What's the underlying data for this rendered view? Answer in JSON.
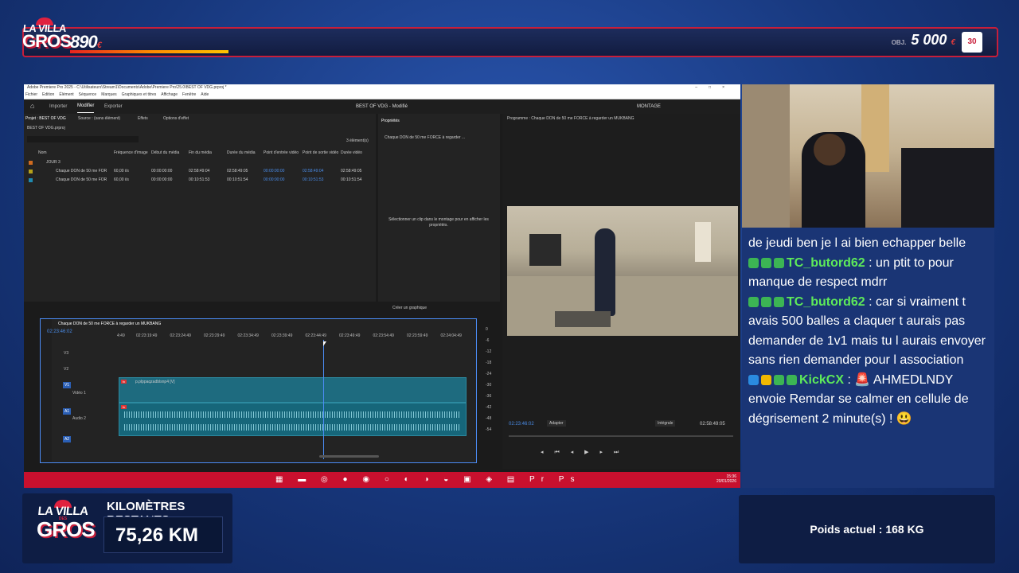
{
  "overlay": {
    "top_counter": {
      "value": "890",
      "currency": "€"
    },
    "top_goal": {
      "label": "OBJ.",
      "value": "5 000",
      "currency": "€"
    },
    "progress_fraction": 0.178,
    "badge": "30",
    "logo": {
      "line1": "LA VILLA",
      "line2": "GROS",
      "small": "DES"
    }
  },
  "premiere": {
    "window_title": "Adobe Premiere Pro 2025 - C:\\Utilisateurs\\Stream1\\Documents\\Adobe\\Premiere Pro\\25.0\\BEST OF VDG.prproj *",
    "menu": [
      "Fichier",
      "Edition",
      "Élément",
      "Séquence",
      "Marques",
      "Graphiques et titres",
      "Affichage",
      "Fenêtre",
      "Aide"
    ],
    "header_tabs": [
      "Importer",
      "Modifier",
      "Exporter"
    ],
    "project_title": "BEST OF VDG - Modifié",
    "workspace": "MONTAGE",
    "project_panel": {
      "tabs": [
        "Projet : BEST OF VDG",
        "Source : (sans élément)",
        "Effets",
        "Options d'effet"
      ],
      "file": "BEST OF VDG.prproj",
      "count": "3 élément(s)",
      "columns": [
        "Nom",
        "Fréquence d'image",
        "Début du média",
        "Fin du média",
        "Durée du média",
        "Point d'entrée vidéo",
        "Point de sortie vidéo",
        "Durée vidéo"
      ],
      "rows": [
        {
          "name": "JOUR 3",
          "fps": "",
          "start": "",
          "end": "",
          "dur": "",
          "in": "",
          "out": "",
          "vdur": ""
        },
        {
          "name": "Chaque DON de 50 me FOR",
          "fps": "60,00 i/s",
          "start": "00:00:00:00",
          "end": "02:58:49:04",
          "dur": "02:58:49:05",
          "in": "00:00:00:00",
          "out": "02:58:49:04",
          "vdur": "02:58:49:05"
        },
        {
          "name": "Chaque DON de 50 me FOR",
          "fps": "60,00 i/s",
          "start": "00:00:00:00",
          "end": "00:10:51:53",
          "dur": "00:10:51:54",
          "in": "00:00:00:00",
          "out": "00:10:51:53",
          "vdur": "00:10:51:54"
        }
      ]
    },
    "properties_panel": {
      "title": "Propriétés",
      "item": "Chaque DON de 50 me FORCE à regarder ...",
      "empty_msg": "Sélectionner un clip dans le montage pour en afficher les propriétés.",
      "create_graphic": "Créer un graphique"
    },
    "program_panel": {
      "title": "Programme : Chaque DON de 50 me FORCE à regarder un MUKBANG",
      "timecode": "02:23:46:02",
      "fit": "Adapter",
      "quality": "Intégrale",
      "duration": "02:58:49:05"
    },
    "timeline": {
      "tab": "Chaque DON de 50 me FORCE à regarder un MUKBANG",
      "timecode": "02:23:46:02",
      "ruler": [
        "4:49",
        "02:23:19:49",
        "02:23:24:49",
        "02:23:29:49",
        "02:23:34:49",
        "02:23:39:49",
        "02:23:44:49",
        "02:23:49:49",
        "02:23:54:49",
        "02:23:59:49",
        "02:24:04:49"
      ],
      "tracks": [
        "V3",
        "V2",
        "V1",
        "A1",
        "A2"
      ],
      "video1_label": "Vidéo 1",
      "audio2_label": "Audio 2",
      "clip_name": "p.plppaqzadblsnp4 [V]",
      "meter_scale": [
        "0",
        "-6",
        "-12",
        "-18",
        "-24",
        "-30",
        "-36",
        "-42",
        "-48",
        "-54"
      ]
    },
    "taskbar": {
      "time": "15:36",
      "date": "20/01/2026"
    }
  },
  "chat": [
    {
      "user": "",
      "text": "de jeudi ben je l ai bien echapper belle",
      "icons": []
    },
    {
      "user": "TC_butord62",
      "text": "un ptit to pour manque de respect mdrr",
      "icons": [
        "#3cb554",
        "#3cb554",
        "#3cb554"
      ]
    },
    {
      "user": "TC_butord62",
      "text": "car si vraiment t avais 500 balles a claquer t aurais pas demander de 1v1 mais tu l aurais envoyer sans rien demander pour l association",
      "icons": [
        "#3cb554",
        "#3cb554",
        "#3cb554"
      ]
    },
    {
      "user": "KickCX",
      "text": "🚨 AHMEDLNDY envoie Remdar se calmer en cellule de dégrisement 2 minute(s) ! 😃",
      "icons": [
        "#2a8be0",
        "#f0b800",
        "#3cb554",
        "#3cb554"
      ]
    }
  ],
  "km": {
    "title_bold": "KILOMÈTRES",
    "title_rest": " RESTANTS :",
    "value": "75,26 KM"
  },
  "poids": {
    "text": "Poids actuel : 168 KG"
  }
}
